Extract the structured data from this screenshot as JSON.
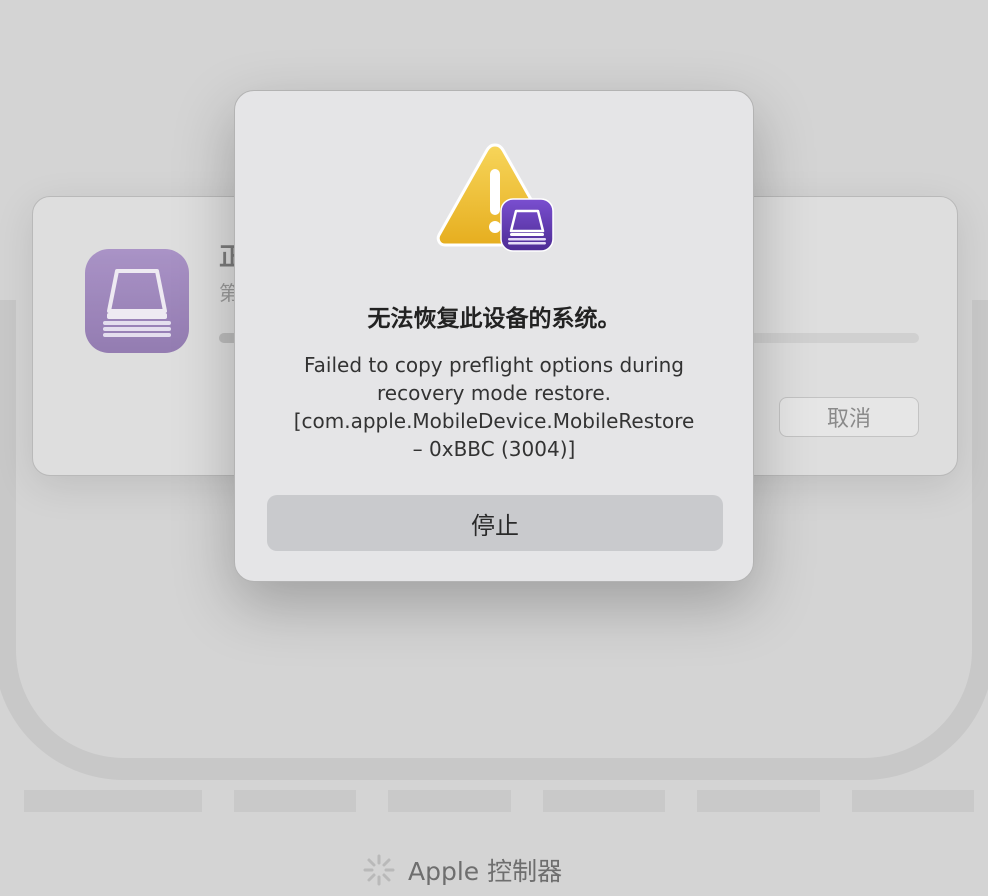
{
  "background": {
    "sheet": {
      "title_fragment": "正",
      "subtitle_fragment": "第",
      "cancel_label": "取消",
      "progress_fraction": 0.06
    },
    "bottom_label": "Apple 控制器"
  },
  "alert": {
    "icon": "warning-triangle-icon with apple-configurator-badge-icon",
    "title": "无法恢复此设备的系统。",
    "message_lines": [
      "Failed to copy preflight options during",
      "recovery mode restore.",
      "[com.apple.MobileDevice.MobileRestore",
      "– 0xBBC (3004)]"
    ],
    "stop_label": "停止"
  },
  "colors": {
    "warning_yellow": "#F2C12E",
    "badge_purple": "#5E3AA8",
    "app_icon_purple": "#9A80BC"
  }
}
